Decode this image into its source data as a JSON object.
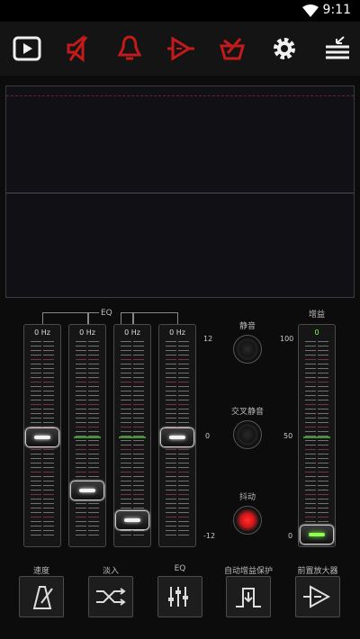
{
  "status_bar": {
    "time": "9:11"
  },
  "toolbar": {
    "icons": [
      "play-icon",
      "mute-speaker-icon",
      "bell-icon",
      "amplifier-icon",
      "crossed-item-icon",
      "settings-icon",
      "menu-icon"
    ],
    "colors": {
      "accent_red": "#c41a1a",
      "white": "#f0f0f0"
    }
  },
  "eq": {
    "title": "EQ",
    "bands": [
      {
        "label": "0 Hz",
        "level": 0
      },
      {
        "label": "0 Hz",
        "level": -5
      },
      {
        "label": "0 Hz",
        "level": -9
      },
      {
        "label": "0 Hz",
        "level": 0
      }
    ],
    "scale": {
      "top": "12",
      "mid": "0",
      "bottom": "-12"
    }
  },
  "controls": {
    "mute_label": "静音",
    "cross_mute_label": "交叉静音",
    "dither_label": "抖动"
  },
  "gain": {
    "title": "增益",
    "value": "0",
    "scale": {
      "top": "100",
      "mid": "50",
      "bottom": "0"
    }
  },
  "bottom": {
    "speed_label": "速度",
    "fade_label": "淡入",
    "eq_label": "EQ",
    "agc_label": "自动增益保护",
    "preamp_label": "前置放大器"
  }
}
